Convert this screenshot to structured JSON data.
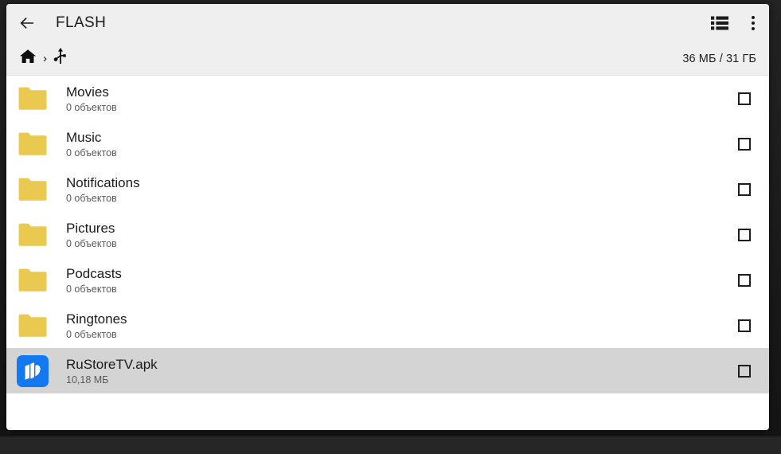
{
  "appbar": {
    "back_icon": "arrow-left-icon",
    "title": "FLASH",
    "view_toggle_icon": "list-view-icon",
    "overflow_icon": "more-vert-icon"
  },
  "breadcrumb": {
    "items": [
      {
        "icon": "home-icon",
        "label": ""
      },
      {
        "icon": "usb-icon",
        "label": ""
      }
    ],
    "separator": "›",
    "storage": "36 МБ / 31 ГБ"
  },
  "list": {
    "rows": [
      {
        "name": "Movies",
        "sub": "0 объектов",
        "icon": "folder-icon",
        "selected": false,
        "checked": false
      },
      {
        "name": "Music",
        "sub": "0 объектов",
        "icon": "folder-icon",
        "selected": false,
        "checked": false
      },
      {
        "name": "Notifications",
        "sub": "0 объектов",
        "icon": "folder-icon",
        "selected": false,
        "checked": false
      },
      {
        "name": "Pictures",
        "sub": "0 объектов",
        "icon": "folder-icon",
        "selected": false,
        "checked": false
      },
      {
        "name": "Podcasts",
        "sub": "0 объектов",
        "icon": "folder-icon",
        "selected": false,
        "checked": false
      },
      {
        "name": "Ringtones",
        "sub": "0 объектов",
        "icon": "folder-icon",
        "selected": false,
        "checked": false
      },
      {
        "name": "RuStoreTV.apk",
        "sub": "10,18 МБ",
        "icon": "rustore-apk-icon",
        "selected": true,
        "checked": false
      }
    ]
  },
  "colors": {
    "appbar_bg": "#efefef",
    "folder": "#e9c94f",
    "rustore_blue": "#1478f0",
    "selected_row": "#d4d4d4",
    "text_primary": "#1b1b1b",
    "text_secondary": "#5b5b5b"
  }
}
